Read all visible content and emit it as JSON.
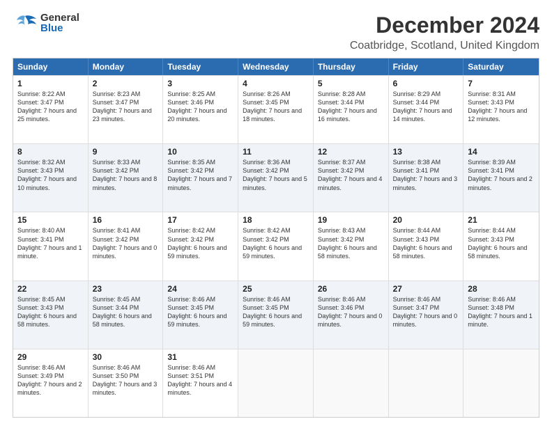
{
  "header": {
    "logo": {
      "line1": "General",
      "line2": "Blue"
    },
    "title": "December 2024",
    "subtitle": "Coatbridge, Scotland, United Kingdom"
  },
  "calendar": {
    "days": [
      "Sunday",
      "Monday",
      "Tuesday",
      "Wednesday",
      "Thursday",
      "Friday",
      "Saturday"
    ],
    "rows": [
      [
        {
          "day": "1",
          "sunrise": "Sunrise: 8:22 AM",
          "sunset": "Sunset: 3:47 PM",
          "daylight": "Daylight: 7 hours and 25 minutes."
        },
        {
          "day": "2",
          "sunrise": "Sunrise: 8:23 AM",
          "sunset": "Sunset: 3:47 PM",
          "daylight": "Daylight: 7 hours and 23 minutes."
        },
        {
          "day": "3",
          "sunrise": "Sunrise: 8:25 AM",
          "sunset": "Sunset: 3:46 PM",
          "daylight": "Daylight: 7 hours and 20 minutes."
        },
        {
          "day": "4",
          "sunrise": "Sunrise: 8:26 AM",
          "sunset": "Sunset: 3:45 PM",
          "daylight": "Daylight: 7 hours and 18 minutes."
        },
        {
          "day": "5",
          "sunrise": "Sunrise: 8:28 AM",
          "sunset": "Sunset: 3:44 PM",
          "daylight": "Daylight: 7 hours and 16 minutes."
        },
        {
          "day": "6",
          "sunrise": "Sunrise: 8:29 AM",
          "sunset": "Sunset: 3:44 PM",
          "daylight": "Daylight: 7 hours and 14 minutes."
        },
        {
          "day": "7",
          "sunrise": "Sunrise: 8:31 AM",
          "sunset": "Sunset: 3:43 PM",
          "daylight": "Daylight: 7 hours and 12 minutes."
        }
      ],
      [
        {
          "day": "8",
          "sunrise": "Sunrise: 8:32 AM",
          "sunset": "Sunset: 3:43 PM",
          "daylight": "Daylight: 7 hours and 10 minutes."
        },
        {
          "day": "9",
          "sunrise": "Sunrise: 8:33 AM",
          "sunset": "Sunset: 3:42 PM",
          "daylight": "Daylight: 7 hours and 8 minutes."
        },
        {
          "day": "10",
          "sunrise": "Sunrise: 8:35 AM",
          "sunset": "Sunset: 3:42 PM",
          "daylight": "Daylight: 7 hours and 7 minutes."
        },
        {
          "day": "11",
          "sunrise": "Sunrise: 8:36 AM",
          "sunset": "Sunset: 3:42 PM",
          "daylight": "Daylight: 7 hours and 5 minutes."
        },
        {
          "day": "12",
          "sunrise": "Sunrise: 8:37 AM",
          "sunset": "Sunset: 3:42 PM",
          "daylight": "Daylight: 7 hours and 4 minutes."
        },
        {
          "day": "13",
          "sunrise": "Sunrise: 8:38 AM",
          "sunset": "Sunset: 3:41 PM",
          "daylight": "Daylight: 7 hours and 3 minutes."
        },
        {
          "day": "14",
          "sunrise": "Sunrise: 8:39 AM",
          "sunset": "Sunset: 3:41 PM",
          "daylight": "Daylight: 7 hours and 2 minutes."
        }
      ],
      [
        {
          "day": "15",
          "sunrise": "Sunrise: 8:40 AM",
          "sunset": "Sunset: 3:41 PM",
          "daylight": "Daylight: 7 hours and 1 minute."
        },
        {
          "day": "16",
          "sunrise": "Sunrise: 8:41 AM",
          "sunset": "Sunset: 3:42 PM",
          "daylight": "Daylight: 7 hours and 0 minutes."
        },
        {
          "day": "17",
          "sunrise": "Sunrise: 8:42 AM",
          "sunset": "Sunset: 3:42 PM",
          "daylight": "Daylight: 6 hours and 59 minutes."
        },
        {
          "day": "18",
          "sunrise": "Sunrise: 8:42 AM",
          "sunset": "Sunset: 3:42 PM",
          "daylight": "Daylight: 6 hours and 59 minutes."
        },
        {
          "day": "19",
          "sunrise": "Sunrise: 8:43 AM",
          "sunset": "Sunset: 3:42 PM",
          "daylight": "Daylight: 6 hours and 58 minutes."
        },
        {
          "day": "20",
          "sunrise": "Sunrise: 8:44 AM",
          "sunset": "Sunset: 3:43 PM",
          "daylight": "Daylight: 6 hours and 58 minutes."
        },
        {
          "day": "21",
          "sunrise": "Sunrise: 8:44 AM",
          "sunset": "Sunset: 3:43 PM",
          "daylight": "Daylight: 6 hours and 58 minutes."
        }
      ],
      [
        {
          "day": "22",
          "sunrise": "Sunrise: 8:45 AM",
          "sunset": "Sunset: 3:43 PM",
          "daylight": "Daylight: 6 hours and 58 minutes."
        },
        {
          "day": "23",
          "sunrise": "Sunrise: 8:45 AM",
          "sunset": "Sunset: 3:44 PM",
          "daylight": "Daylight: 6 hours and 58 minutes."
        },
        {
          "day": "24",
          "sunrise": "Sunrise: 8:46 AM",
          "sunset": "Sunset: 3:45 PM",
          "daylight": "Daylight: 6 hours and 59 minutes."
        },
        {
          "day": "25",
          "sunrise": "Sunrise: 8:46 AM",
          "sunset": "Sunset: 3:45 PM",
          "daylight": "Daylight: 6 hours and 59 minutes."
        },
        {
          "day": "26",
          "sunrise": "Sunrise: 8:46 AM",
          "sunset": "Sunset: 3:46 PM",
          "daylight": "Daylight: 7 hours and 0 minutes."
        },
        {
          "day": "27",
          "sunrise": "Sunrise: 8:46 AM",
          "sunset": "Sunset: 3:47 PM",
          "daylight": "Daylight: 7 hours and 0 minutes."
        },
        {
          "day": "28",
          "sunrise": "Sunrise: 8:46 AM",
          "sunset": "Sunset: 3:48 PM",
          "daylight": "Daylight: 7 hours and 1 minute."
        }
      ],
      [
        {
          "day": "29",
          "sunrise": "Sunrise: 8:46 AM",
          "sunset": "Sunset: 3:49 PM",
          "daylight": "Daylight: 7 hours and 2 minutes."
        },
        {
          "day": "30",
          "sunrise": "Sunrise: 8:46 AM",
          "sunset": "Sunset: 3:50 PM",
          "daylight": "Daylight: 7 hours and 3 minutes."
        },
        {
          "day": "31",
          "sunrise": "Sunrise: 8:46 AM",
          "sunset": "Sunset: 3:51 PM",
          "daylight": "Daylight: 7 hours and 4 minutes."
        },
        null,
        null,
        null,
        null
      ]
    ]
  }
}
